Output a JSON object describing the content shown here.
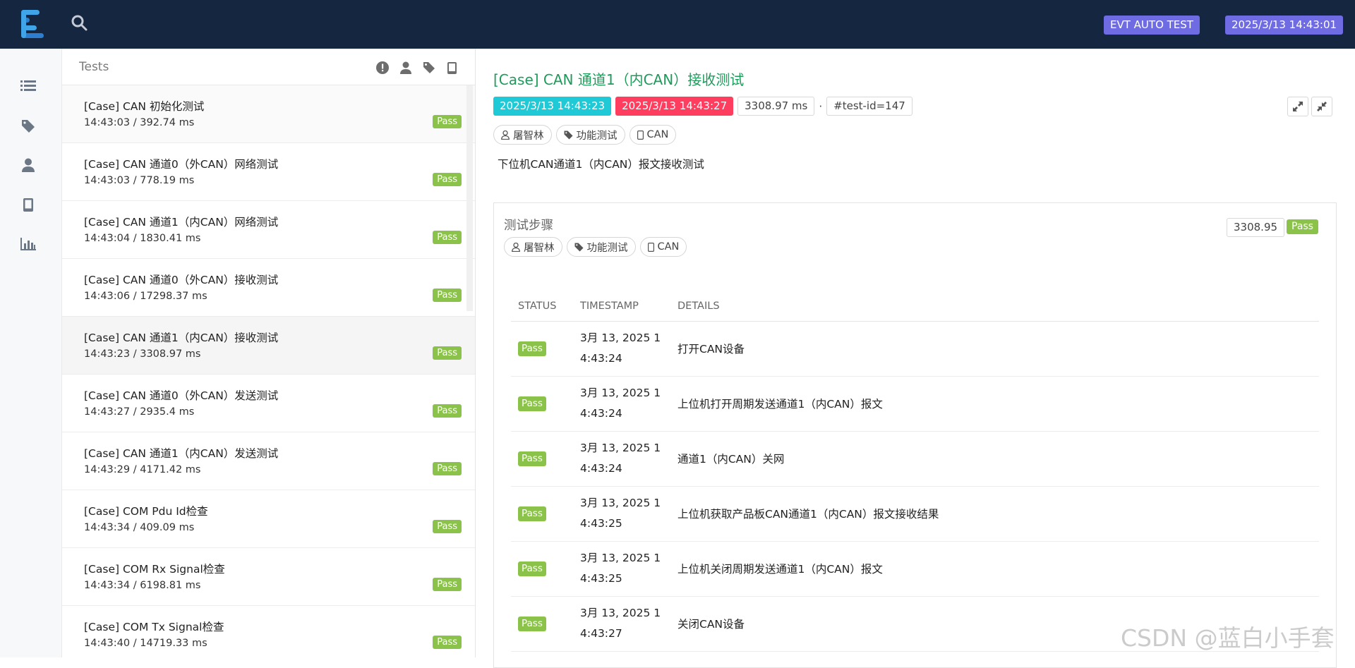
{
  "header": {
    "project_badge": "EVT AUTO TEST",
    "time_badge": "2025/3/13 14:43:01"
  },
  "sidenav": {
    "items": [
      "list-icon",
      "tag-icon",
      "user-icon",
      "device-icon",
      "chart-icon"
    ]
  },
  "tests_panel": {
    "title": "Tests",
    "filter_icons": [
      "status-filter-icon",
      "author-filter-icon",
      "tag-filter-icon",
      "device-filter-icon"
    ],
    "items": [
      {
        "name": "[Case] CAN 初始化测试",
        "meta": "14:43:03 / 392.74 ms",
        "status": "Pass"
      },
      {
        "name": "[Case] CAN 通道0（外CAN）网络测试",
        "meta": "14:43:03 / 778.19 ms",
        "status": "Pass"
      },
      {
        "name": "[Case] CAN 通道1（内CAN）网络测试",
        "meta": "14:43:04 / 1830.41 ms",
        "status": "Pass"
      },
      {
        "name": "[Case] CAN 通道0（外CAN）接收测试",
        "meta": "14:43:06 / 17298.37 ms",
        "status": "Pass"
      },
      {
        "name": "[Case] CAN 通道1（内CAN）接收测试",
        "meta": "14:43:23 / 3308.97 ms",
        "status": "Pass"
      },
      {
        "name": "[Case] CAN 通道0（外CAN）发送测试",
        "meta": "14:43:27 / 2935.4 ms",
        "status": "Pass"
      },
      {
        "name": "[Case] CAN 通道1（内CAN）发送测试",
        "meta": "14:43:29 / 4171.42 ms",
        "status": "Pass"
      },
      {
        "name": "[Case] COM Pdu Id检查",
        "meta": "14:43:34 / 409.09 ms",
        "status": "Pass"
      },
      {
        "name": "[Case] COM Rx Signal检查",
        "meta": "14:43:34 / 6198.81 ms",
        "status": "Pass"
      },
      {
        "name": "[Case] COM Tx Signal检查",
        "meta": "14:43:40 / 14719.33 ms",
        "status": "Pass"
      }
    ]
  },
  "detail": {
    "title": "[Case] CAN 通道1（内CAN）接收测试",
    "start_time": "2025/3/13 14:43:23",
    "end_time": "2025/3/13 14:43:27",
    "duration": "3308.97 ms",
    "separator": "·",
    "test_id": "#test-id=147",
    "tags": {
      "author": "屠智林",
      "category": "功能测试",
      "device": "CAN"
    },
    "description": "下位机CAN通道1（内CAN）报文接收测试",
    "steps": {
      "title": "测试步骤",
      "duration": "3308.95",
      "status": "Pass",
      "tags": {
        "author": "屠智林",
        "category": "功能测试",
        "device": "CAN"
      },
      "columns": [
        "STATUS",
        "TIMESTAMP",
        "DETAILS"
      ],
      "rows": [
        {
          "status": "Pass",
          "timestamp": "3月 13, 2025 1\n4:43:24",
          "details": "打开CAN设备"
        },
        {
          "status": "Pass",
          "timestamp": "3月 13, 2025 1\n4:43:24",
          "details": "上位机打开周期发送通道1（内CAN）报文"
        },
        {
          "status": "Pass",
          "timestamp": "3月 13, 2025 1\n4:43:24",
          "details": "通道1（内CAN）关网"
        },
        {
          "status": "Pass",
          "timestamp": "3月 13, 2025 1\n4:43:25",
          "details": "上位机获取产品板CAN通道1（内CAN）报文接收结果"
        },
        {
          "status": "Pass",
          "timestamp": "3月 13, 2025 1\n4:43:25",
          "details": "上位机关闭周期发送通道1（内CAN）报文"
        },
        {
          "status": "Pass",
          "timestamp": "3月 13, 2025 1\n4:43:27",
          "details": "关闭CAN设备"
        }
      ]
    }
  },
  "watermark": "CSDN @蓝白小手套",
  "colors": {
    "topbar": "#142640",
    "badge": "#6f6be3",
    "pass": "#8bc34a",
    "title_green": "#1e9b5a",
    "start_chip": "#1fc9d6",
    "end_chip": "#ff3d5f"
  }
}
